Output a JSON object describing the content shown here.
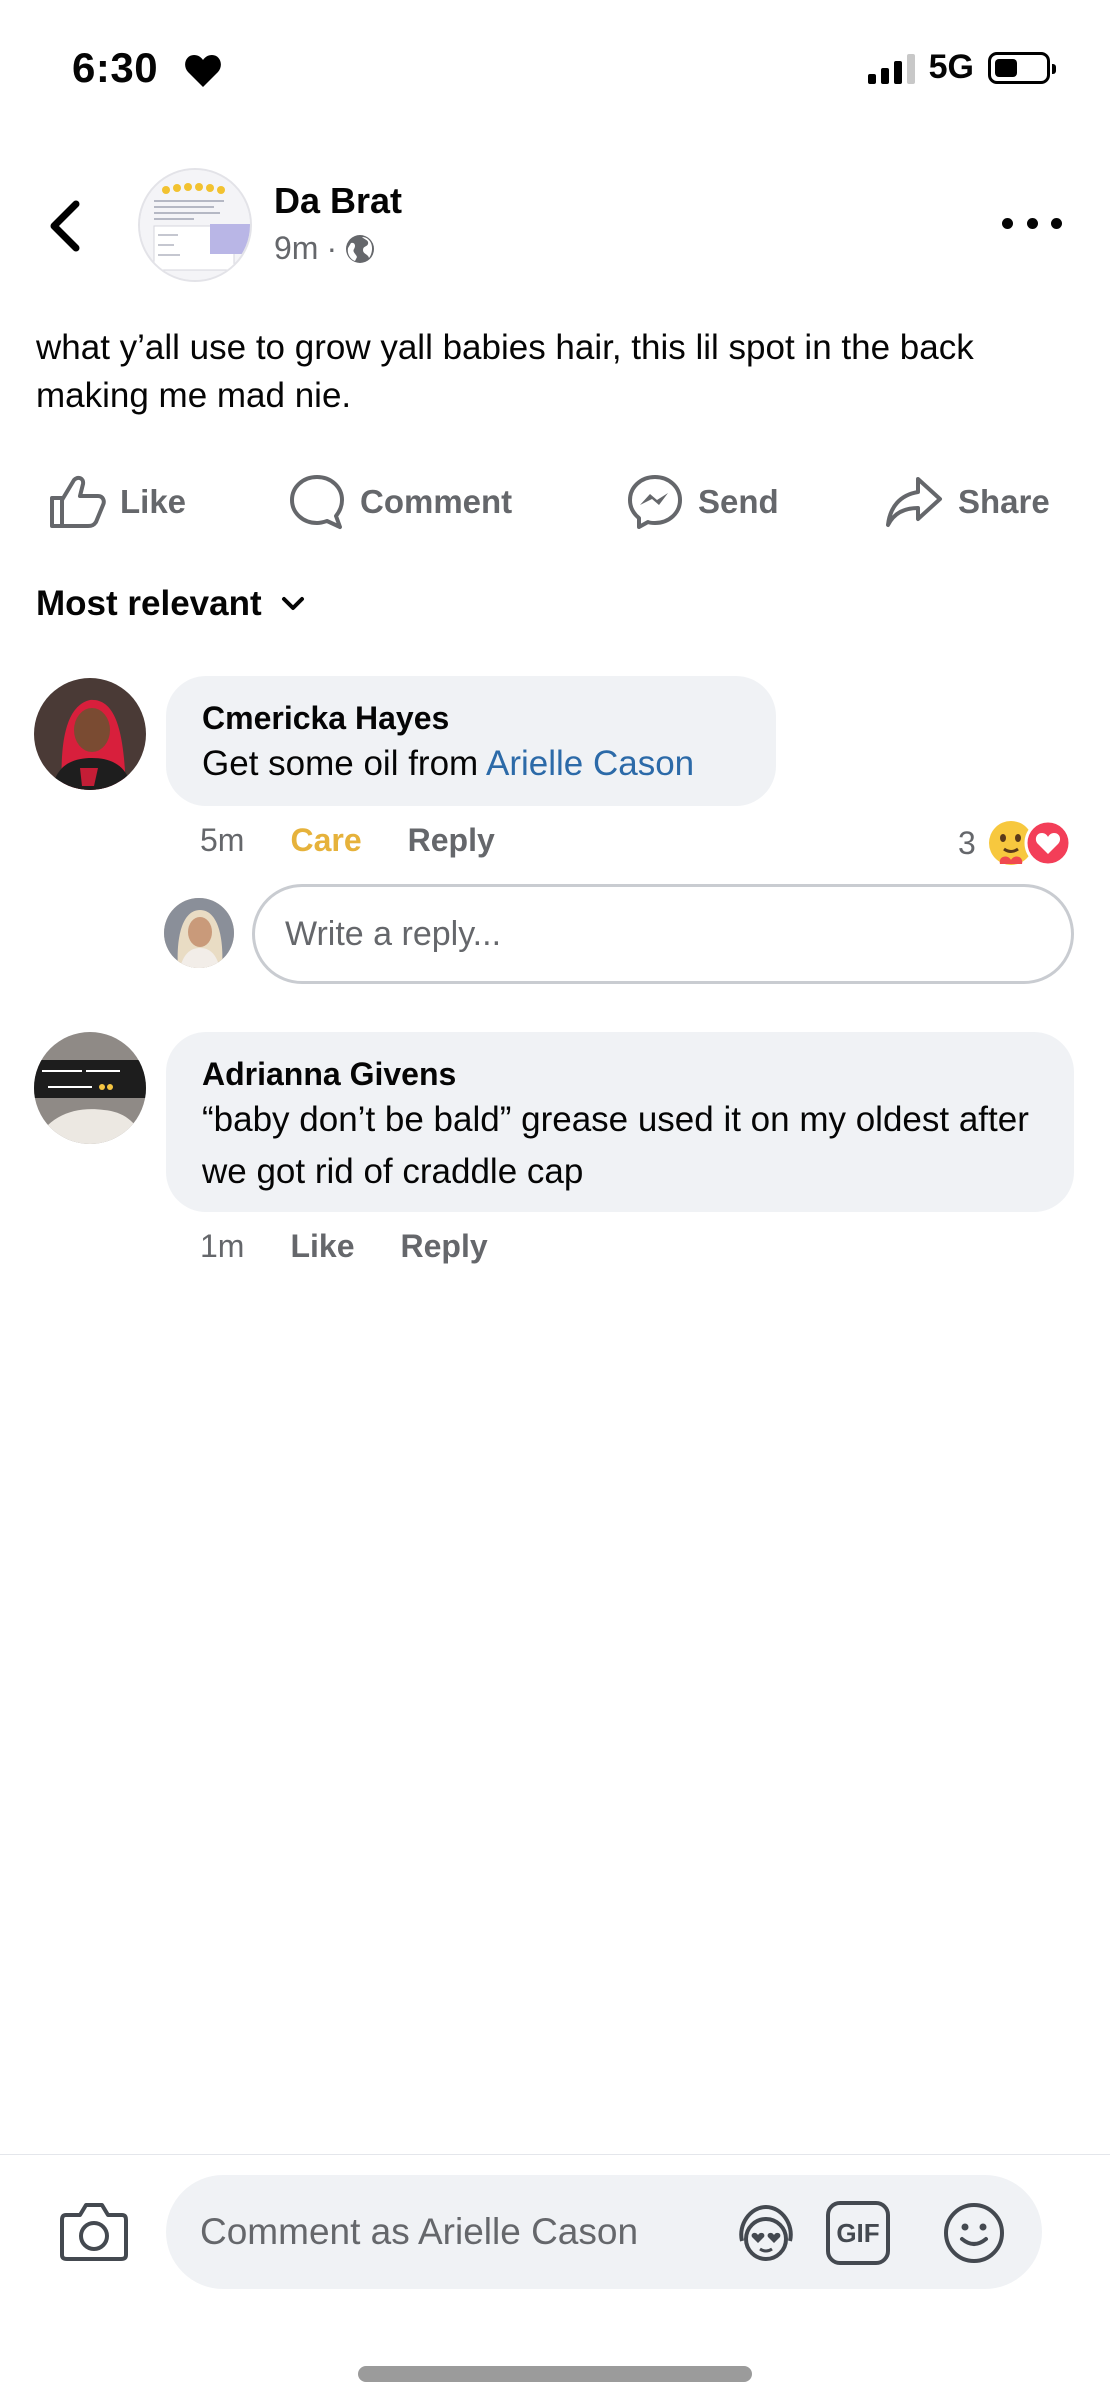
{
  "status_bar": {
    "time": "6:30",
    "network": "5G"
  },
  "post": {
    "author": "Da Brat",
    "age": "9m",
    "separator": "·",
    "text": "what y’all use to grow yall babies hair, this lil spot in the back making me mad nie."
  },
  "actions": {
    "like": "Like",
    "comment": "Comment",
    "send": "Send",
    "share": "Share"
  },
  "sort_label": "Most relevant",
  "comments": [
    {
      "author": "Cmericka Hayes",
      "text_prefix": "Get some oil from ",
      "mention": "Arielle Cason",
      "time": "5m",
      "reaction_action": "Care",
      "reply": "Reply",
      "reaction_count": "3"
    },
    {
      "author": "Adrianna Givens",
      "text": "“baby don’t be bald” grease used it on my oldest after we got rid of craddle cap",
      "time": "1m",
      "like": "Like",
      "reply": "Reply"
    }
  ],
  "reply_placeholder": "Write a reply...",
  "composer": {
    "placeholder": "Comment as Arielle Cason",
    "gif_label": "GIF"
  },
  "colors": {
    "mention": "#2c6aa8",
    "care": "#e6b23b",
    "bubble": "#f0f2f5",
    "secondary_text": "#65676b"
  }
}
